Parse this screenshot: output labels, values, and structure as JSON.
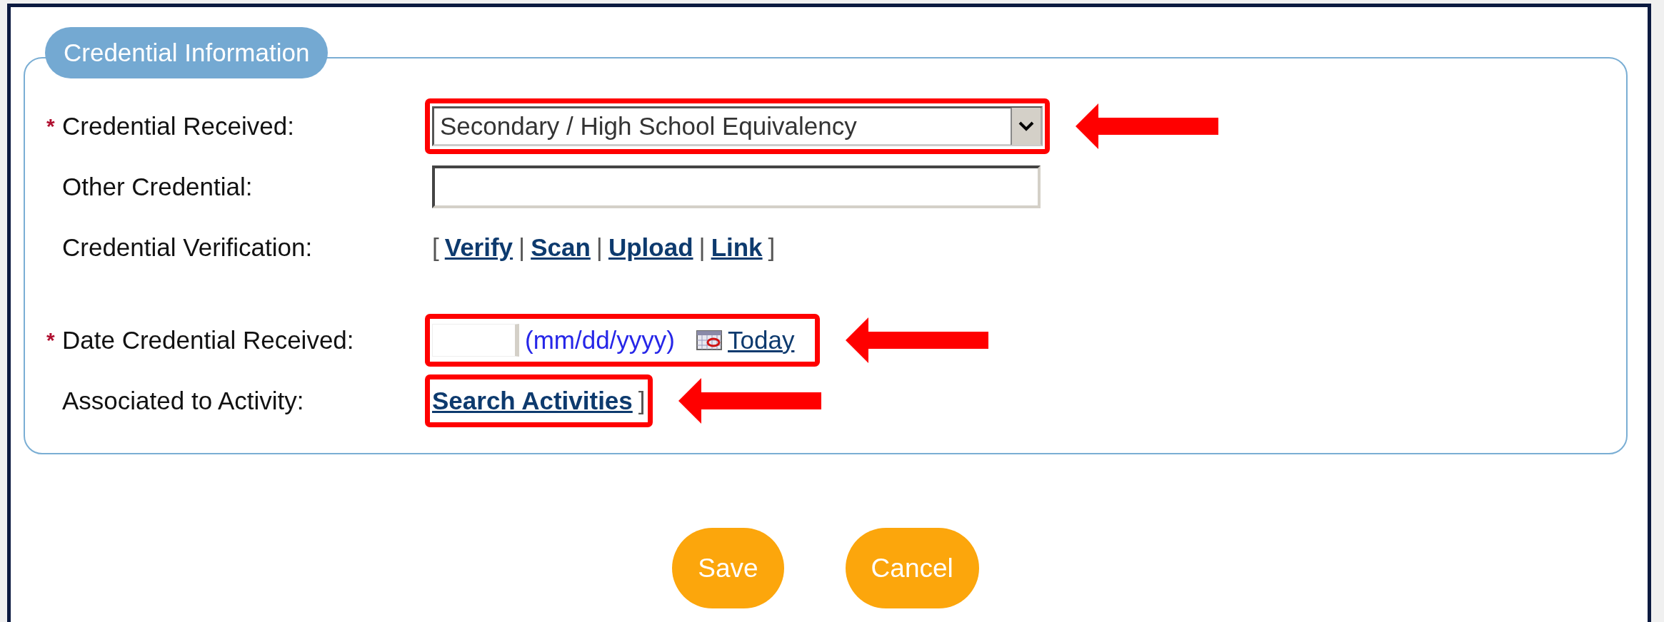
{
  "section": {
    "title": "Credential Information"
  },
  "required_mark": "*",
  "fields": [
    {
      "kind": "select",
      "label": "Credential Received:",
      "required": true,
      "value": "Secondary / High School Equivalency",
      "highlighted": true
    },
    {
      "kind": "text",
      "label": "Other Credential:",
      "required": false,
      "highlighted": false
    },
    {
      "kind": "links",
      "label": "Credential Verification:",
      "required": false,
      "open": "[",
      "links": [
        "Verify",
        "Scan",
        "Upload",
        "Link"
      ],
      "separators": [
        "|",
        "|",
        "|"
      ],
      "close": "]",
      "highlighted": false
    },
    {
      "kind": "date",
      "label": "Date Credential Received:",
      "required": true,
      "hint": "(mm/dd/yyyy)",
      "link": "Today",
      "highlighted": true
    },
    {
      "kind": "activity",
      "label": "Associated to Activity:",
      "required": false,
      "link": "Search Activities",
      "close": "]",
      "highlighted": true
    }
  ],
  "buttons": [
    {
      "label": "Save"
    },
    {
      "label": "Cancel"
    }
  ]
}
